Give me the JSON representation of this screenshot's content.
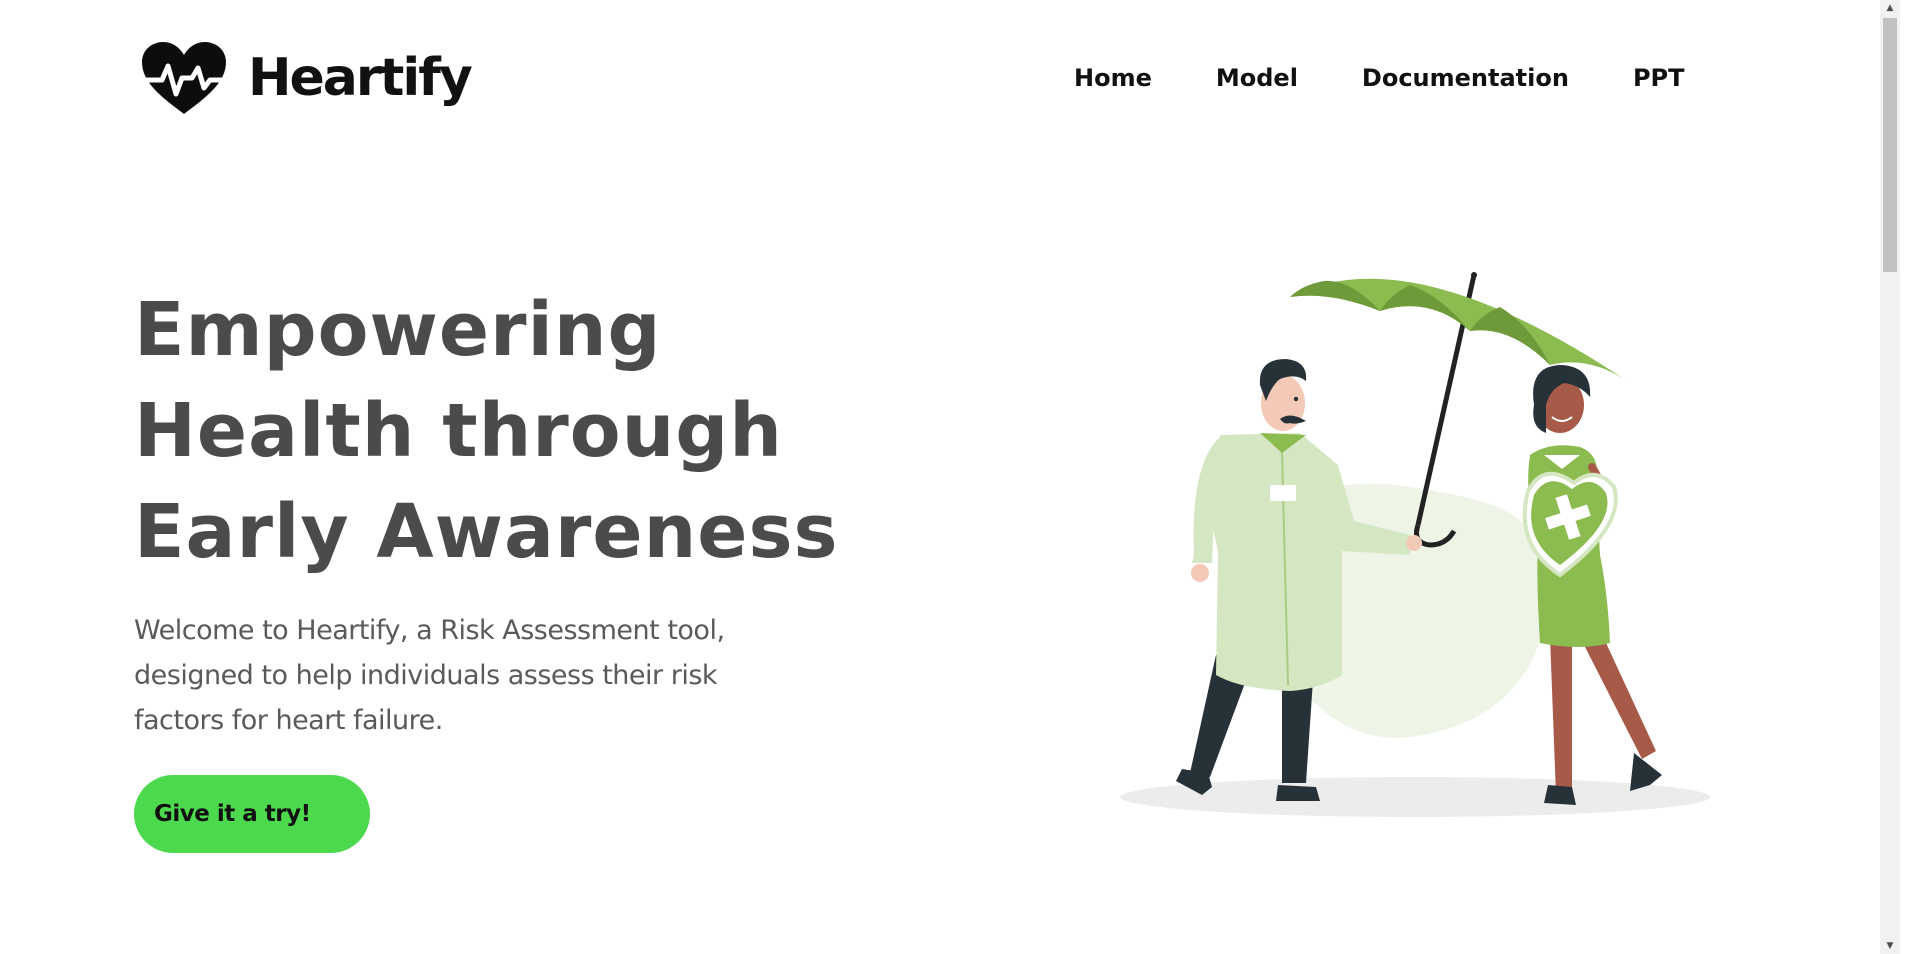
{
  "brand": {
    "name": "Heartify",
    "logo_icon": "heartbeat-heart-icon"
  },
  "nav": {
    "items": [
      {
        "label": "Home"
      },
      {
        "label": "Model"
      },
      {
        "label": "Documentation"
      },
      {
        "label": "PPT"
      }
    ]
  },
  "hero": {
    "title": "Empowering Health through Early Awareness",
    "subtitle": "Welcome to Heartify, a Risk Assessment tool, designed to help individuals assess their risk factors for heart failure.",
    "cta_label": "Give it a try!"
  },
  "colors": {
    "accent": "#4dd94d",
    "illustration_green": "#8cbb50",
    "heading": "#4b4b4b"
  },
  "illustration": {
    "subject": "doctor-holding-umbrella-over-woman-with-heart-shield"
  }
}
